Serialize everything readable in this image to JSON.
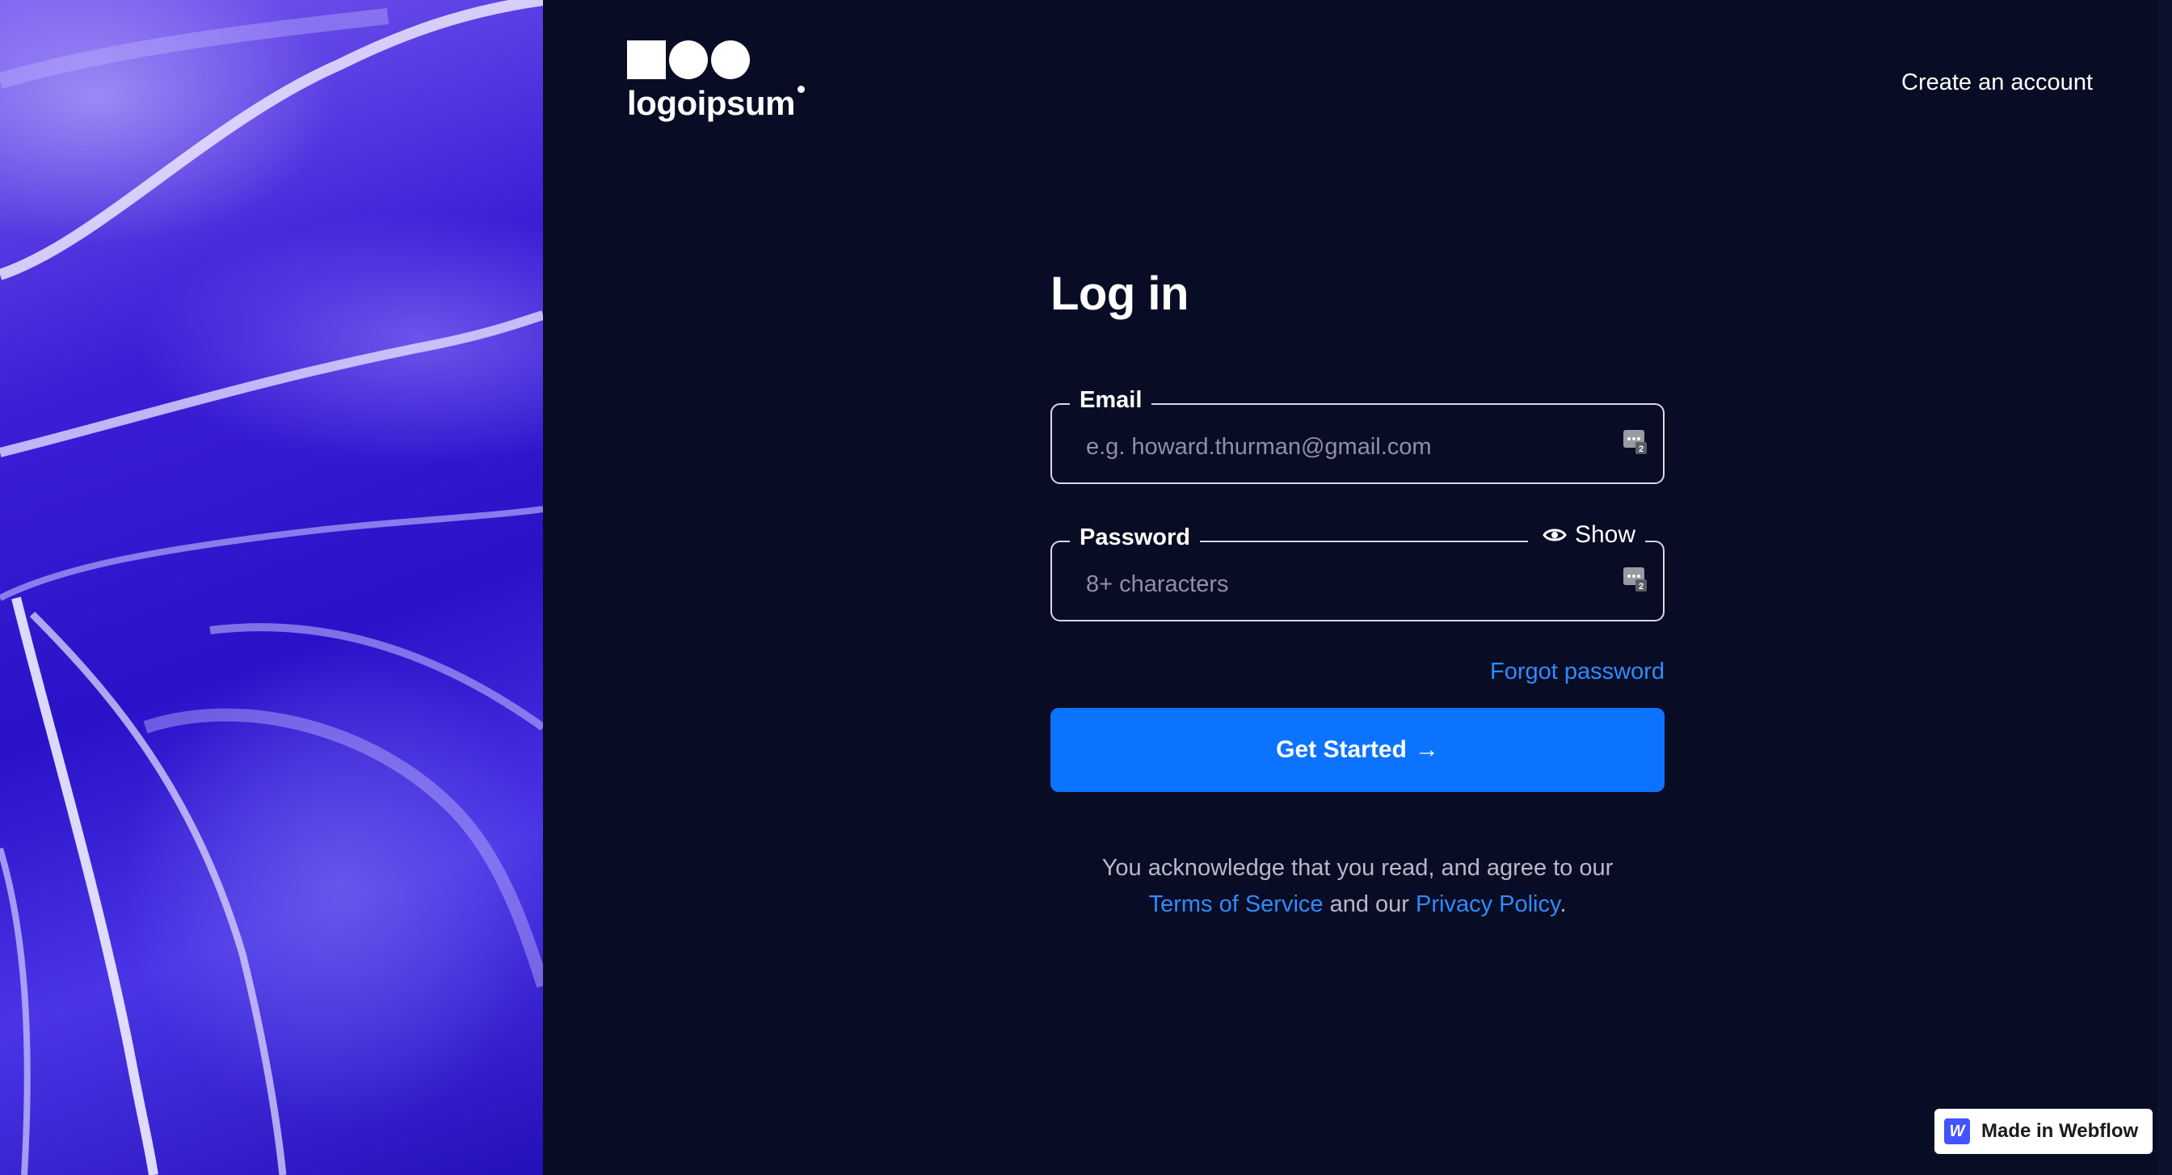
{
  "brand": {
    "logo_text": "logoipsum"
  },
  "header": {
    "create_account_label": "Create an account"
  },
  "form": {
    "title": "Log in",
    "email": {
      "label": "Email",
      "placeholder": "e.g. howard.thurman@gmail.com"
    },
    "password": {
      "label": "Password",
      "placeholder": "8+ characters",
      "show_label": "Show"
    },
    "forgot_label": "Forgot password",
    "submit_label": "Get Started",
    "submit_arrow": "→"
  },
  "legal": {
    "line1": "You acknowledge that you read, and agree to our",
    "terms_label": "Terms of Service",
    "and_text": "and our",
    "privacy_label": "Privacy Policy",
    "period": "."
  },
  "badge": {
    "mark": "W",
    "label": "Made in Webflow"
  },
  "colors": {
    "background": "#080c24",
    "accent": "#0b73ff",
    "link": "#2f8bff",
    "art": "#3b1fd6"
  },
  "icons": [
    "password-manager-key-icon",
    "eye-icon",
    "arrow-right-icon",
    "webflow-icon"
  ]
}
